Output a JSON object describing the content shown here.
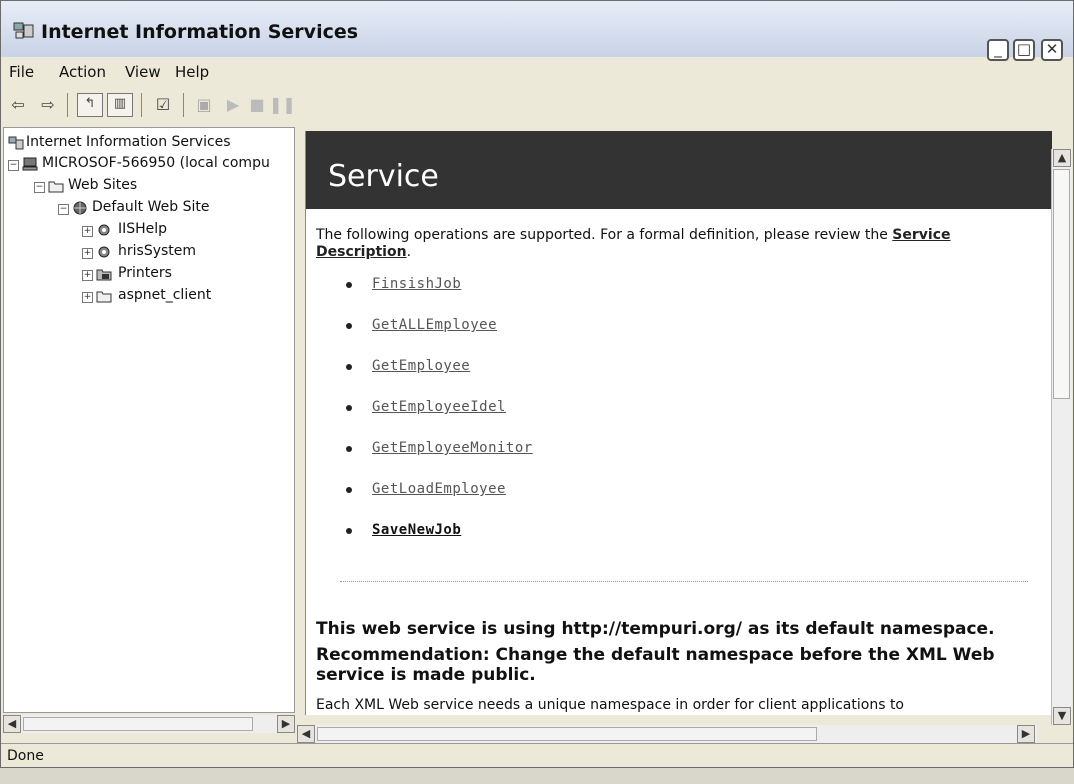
{
  "window": {
    "title": "Internet Information Services",
    "controls": [
      "minimize-icon",
      "maximize-icon",
      "close-icon"
    ]
  },
  "menu": [
    "File",
    "Action",
    "View",
    "Help"
  ],
  "toolbar": {
    "icons": [
      "back-arrow-icon",
      "forward-arrow-icon",
      "up-folder-icon",
      "show-hide-tree-icon",
      "properties-icon",
      "computer-icon",
      "play-icon",
      "stop-icon",
      "pause-icon"
    ]
  },
  "tree": {
    "root": "Internet Information Services",
    "computer": "MICROSOF-566950 (local compu",
    "web_sites": "Web Sites",
    "default_site": "Default Web Site",
    "children": [
      "IISHelp",
      "hrisSystem",
      "Printers",
      "aspnet_client"
    ]
  },
  "content": {
    "banner_title": "Service",
    "intro": "The following operations are supported. For a formal definition, please review the ",
    "service_description_link": "Service Description",
    "intro_end": ".",
    "operations": [
      "FinsishJob",
      "GetALLEmployee",
      "GetEmployee",
      "GetEmployeeIdel",
      "GetEmployeeMonitor",
      "GetLoadEmployee",
      "SaveNewJob"
    ],
    "namespace_heading": "This web service is using http://tempuri.org/ as its default namespace.",
    "recommendation": "Recommendation: Change the default namespace before the XML Web service is made public.",
    "explanation": "Each XML Web service needs a unique namespace in order for client applications to"
  },
  "status": {
    "text": "Done"
  },
  "colors": {
    "banner": "#333333",
    "window_bg": "#ece9d8"
  }
}
